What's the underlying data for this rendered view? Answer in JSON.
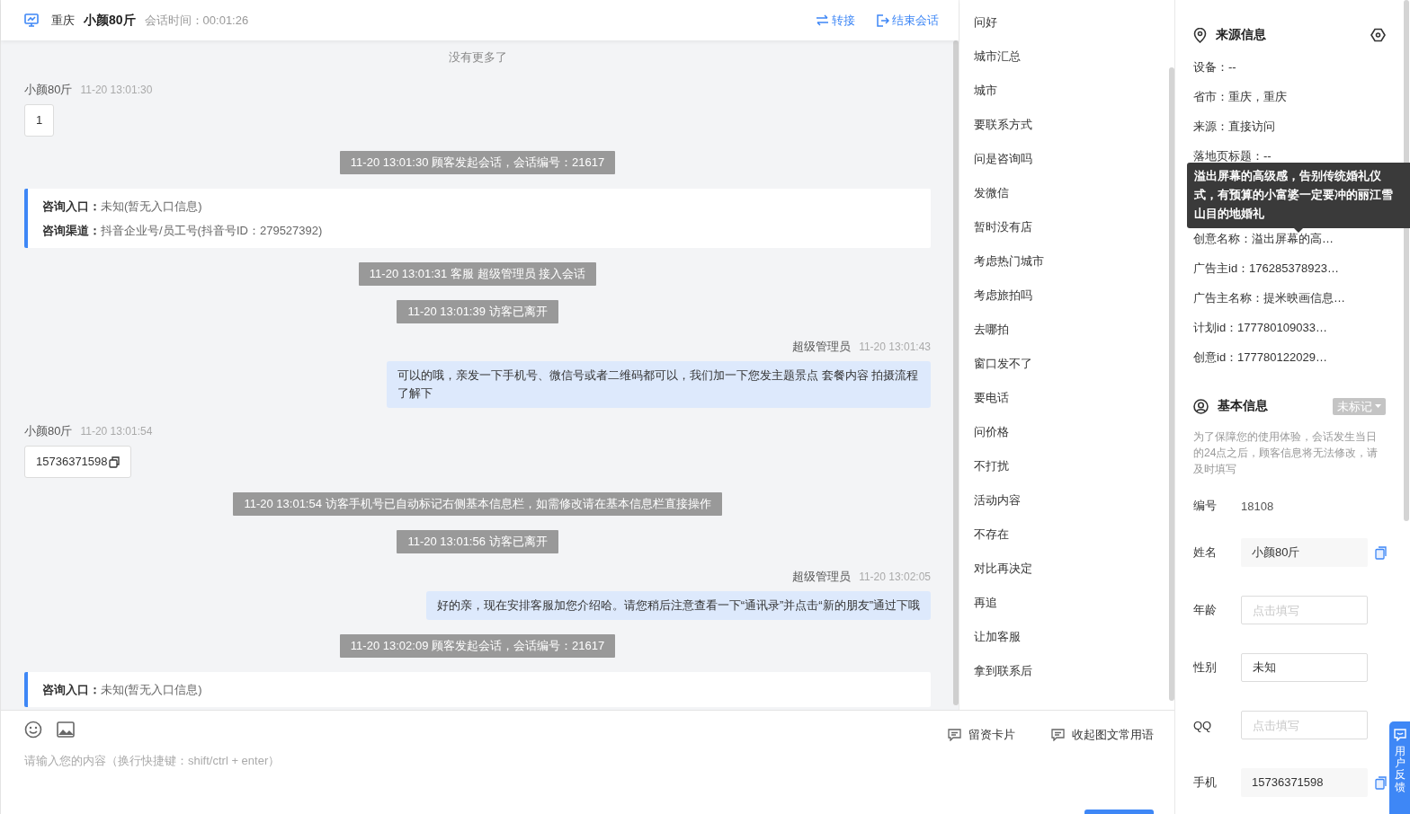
{
  "header": {
    "location": "重庆",
    "visitor": "小颜80斤",
    "duration": "会话时间：00:01:26",
    "actions": [
      {
        "kind": "transfer",
        "label": "转接"
      },
      {
        "kind": "end",
        "label": "结束会话"
      }
    ]
  },
  "messages": [
    {
      "kind": "note",
      "text": "没有更多了"
    },
    {
      "kind": "visitor",
      "name": "小颜80斤",
      "time": "11-20 13:01:30",
      "text": "1",
      "copyable": false
    },
    {
      "kind": "system",
      "text": "11-20 13:01:30 顾客发起会话，会话编号：21617"
    },
    {
      "kind": "info",
      "lines": [
        {
          "label": "咨询入口：",
          "value": "未知(暂无入口信息)"
        },
        {
          "label": "咨询渠道：",
          "value": "抖音企业号/员工号(抖音号ID：279527392)"
        }
      ]
    },
    {
      "kind": "system",
      "text": "11-20 13:01:31 客服 超级管理员 接入会话"
    },
    {
      "kind": "system",
      "text": "11-20 13:01:39 访客已离开"
    },
    {
      "kind": "agent",
      "name": "超级管理员",
      "time": "11-20 13:01:43",
      "text": "可以的哦，亲发一下手机号、微信号或者二维码都可以，我们加一下您发主题景点 套餐内容 拍摄流程了解下"
    },
    {
      "kind": "visitor",
      "name": "小颜80斤",
      "time": "11-20 13:01:54",
      "text": "15736371598",
      "copyable": true
    },
    {
      "kind": "system",
      "text": "11-20 13:01:54 访客手机号已自动标记右侧基本信息栏，如需修改请在基本信息栏直接操作"
    },
    {
      "kind": "system",
      "text": "11-20 13:01:56 访客已离开"
    },
    {
      "kind": "agent",
      "name": "超级管理员",
      "time": "11-20 13:02:05",
      "text": "好的亲，现在安排客服加您介绍哈。请您稍后注意查看一下“通讯录”并点击“新的朋友”通过下哦"
    },
    {
      "kind": "system",
      "text": "11-20 13:02:09 顾客发起会话，会话编号：21617"
    },
    {
      "kind": "info",
      "lines": [
        {
          "label": "咨询入口：",
          "value": "未知(暂无入口信息)"
        }
      ]
    }
  ],
  "phrases": [
    "问好",
    "城市汇总",
    "城市",
    "要联系方式",
    "问是咨询吗",
    "发微信",
    "暂时没有店",
    "考虑热门城市",
    "考虑旅拍吗",
    "去哪拍",
    "窗口发不了",
    "要电话",
    "问价格",
    "不打扰",
    "活动内容",
    "不存在",
    "对比再决定",
    "再追",
    "让加客服",
    "拿到联系后"
  ],
  "composer": {
    "placeholder": "请输入您的内容（换行快捷键：shift/ctrl + enter）",
    "actions": [
      {
        "label": "留资卡片"
      },
      {
        "label": "收起图文常用语"
      }
    ]
  },
  "source_info": {
    "title": "来源信息",
    "rows": [
      "设备：--",
      "省市：重庆，重庆",
      "来源：直接访问",
      "落地页标题：--",
      "创意名称：溢出屏幕的高…",
      "广告主id：176285378923…",
      "广告主名称：提米映画信息…",
      "计划id：177780109033…",
      "创意id：177780122029…"
    ],
    "tooltip": "溢出屏幕的高级感，告别传统婚礼仪式，有预算的小富婆一定要冲的丽江雪山目的地婚礼"
  },
  "basic_info": {
    "title": "基本信息",
    "tag": "未标记",
    "note": "为了保障您的使用体验，会话发生当日的24点之后，顾客信息将无法修改，请及时填写",
    "fields": [
      {
        "label": "编号",
        "kind": "text",
        "value": "18108",
        "copyable": false
      },
      {
        "label": "姓名",
        "kind": "readonly",
        "value": "小颜80斤",
        "copyable": true
      },
      {
        "label": "年龄",
        "kind": "input",
        "placeholder": "点击填写",
        "copyable": false
      },
      {
        "label": "性别",
        "kind": "input",
        "value": "未知",
        "copyable": false
      },
      {
        "label": "QQ",
        "kind": "input",
        "placeholder": "点击填写",
        "copyable": false
      },
      {
        "label": "手机",
        "kind": "readonly",
        "value": "15736371598",
        "copyable": true
      }
    ]
  },
  "feedback_tab": "用户反馈"
}
